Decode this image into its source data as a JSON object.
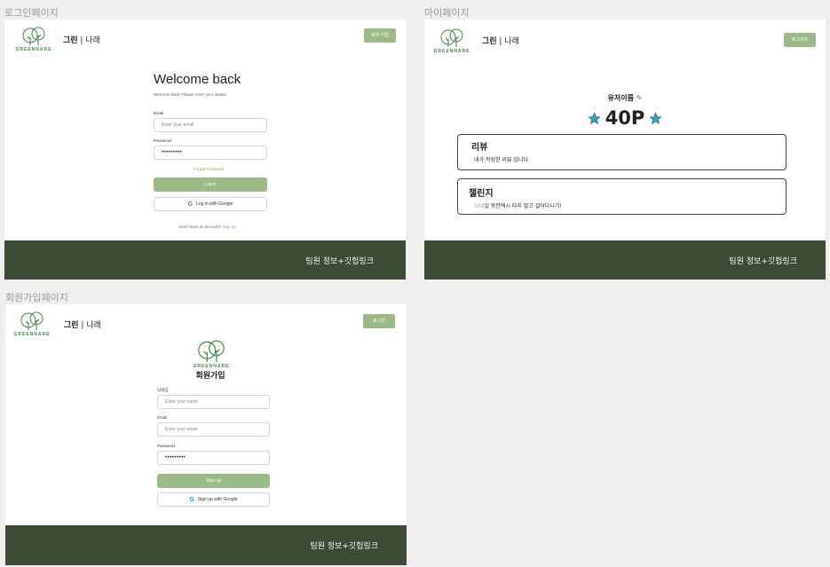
{
  "labels": {
    "login": "로그인페이지",
    "mypage": "마이페이지",
    "signup": "회원가입페이지"
  },
  "brand": {
    "logo_text": "GREENNARE",
    "bold": "그린",
    "sep": " | ",
    "rest": "나래"
  },
  "footer_text": "팀원 정보+깃헙링크",
  "login": {
    "top_button": "회원 가입",
    "title": "Welcome back",
    "subtitle": "Welcome back! Please enter your details.",
    "email_label": "Email",
    "email_placeholder": "Enter your email",
    "password_label": "Password",
    "password_value": "•••••••••",
    "forgot": "Forgot Password",
    "login_button": "Log in",
    "google_button": "Log in with Google",
    "no_account": "Don't have an account?",
    "signup_link": "Sign up"
  },
  "mypage": {
    "top_button": "로그아웃",
    "username": "유저이름",
    "points": "40P",
    "review_title": "리뷰",
    "review_text": "내가 작성한 리뷰 입니다",
    "challenge_title": "챌린지",
    "challenge_number": "100",
    "challenge_text": "일 동안택시 타지 말고 걸어다니기!"
  },
  "signup": {
    "top_button": "로그인",
    "title": "회원가입",
    "name_label": "닉네임",
    "name_placeholder": "Enter your name",
    "email_label": "Email",
    "email_placeholder": "Enter your email",
    "password_label": "Password",
    "password_value": "•••••••••",
    "signup_button": "Sign up",
    "google_button": "Sign up with Google"
  },
  "colors": {
    "accent_green": "#9cba86",
    "footer_green": "#3c4b34",
    "logo_green": "#3e8a45",
    "star_blue": "#3a9fc0"
  }
}
